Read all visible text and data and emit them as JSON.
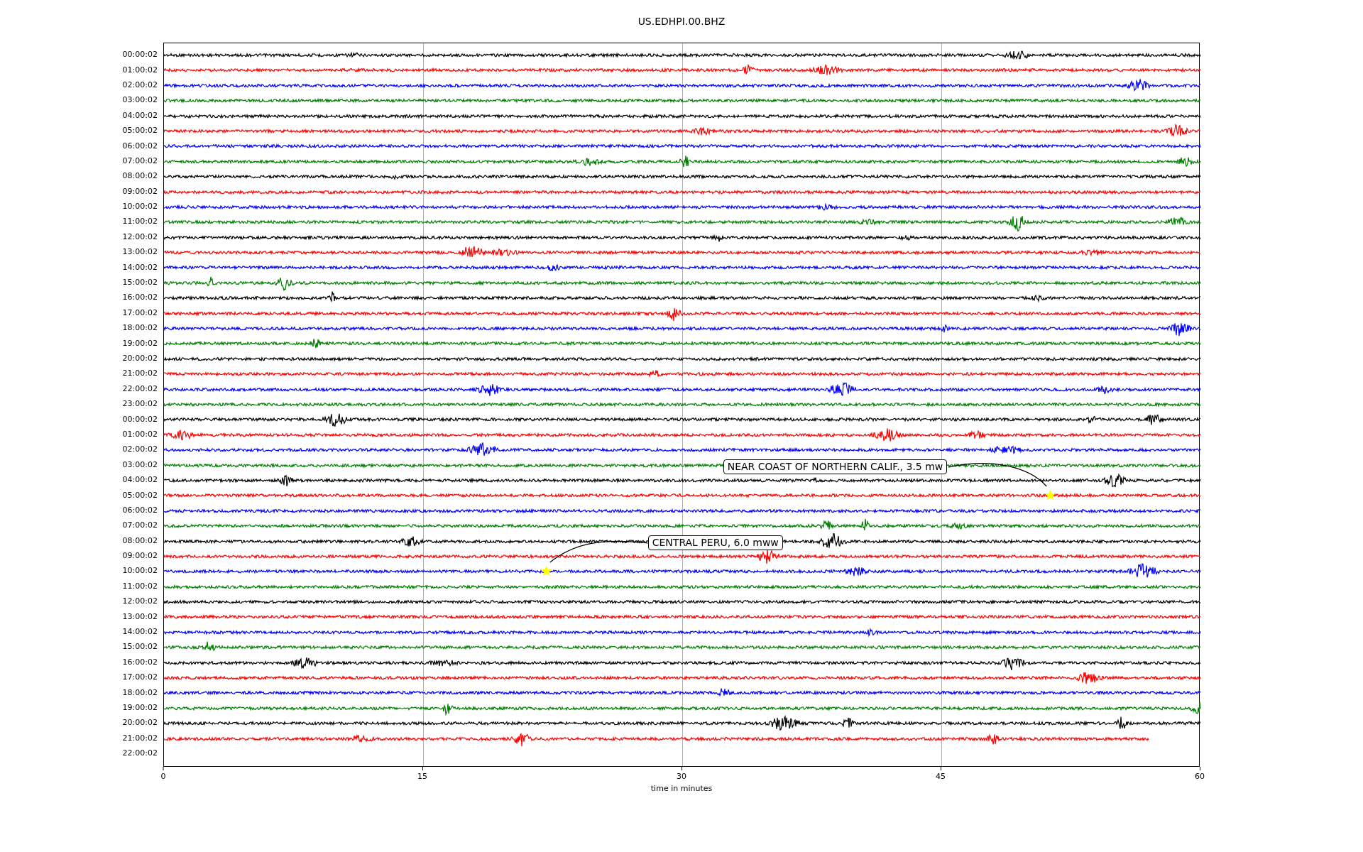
{
  "title": "US.EDHPI.00.BHZ",
  "rows": [
    {
      "label": "00:00:02",
      "color": "#000000",
      "kind": "full"
    },
    {
      "label": "01:00:02",
      "color": "#ff0000",
      "kind": "full"
    },
    {
      "label": "02:00:02",
      "color": "#0000ff",
      "kind": "full"
    },
    {
      "label": "03:00:02",
      "color": "#008000",
      "kind": "full"
    },
    {
      "label": "04:00:02",
      "color": "#000000",
      "kind": "full"
    },
    {
      "label": "05:00:02",
      "color": "#ff0000",
      "kind": "full"
    },
    {
      "label": "06:00:02",
      "color": "#0000ff",
      "kind": "full"
    },
    {
      "label": "07:00:02",
      "color": "#008000",
      "kind": "full"
    },
    {
      "label": "08:00:02",
      "color": "#000000",
      "kind": "full"
    },
    {
      "label": "09:00:02",
      "color": "#ff0000",
      "kind": "full"
    },
    {
      "label": "10:00:02",
      "color": "#0000ff",
      "kind": "full"
    },
    {
      "label": "11:00:02",
      "color": "#008000",
      "kind": "full"
    },
    {
      "label": "12:00:02",
      "color": "#000000",
      "kind": "full"
    },
    {
      "label": "13:00:02",
      "color": "#ff0000",
      "kind": "full"
    },
    {
      "label": "14:00:02",
      "color": "#0000ff",
      "kind": "full"
    },
    {
      "label": "15:00:02",
      "color": "#008000",
      "kind": "full"
    },
    {
      "label": "16:00:02",
      "color": "#000000",
      "kind": "full"
    },
    {
      "label": "17:00:02",
      "color": "#ff0000",
      "kind": "full"
    },
    {
      "label": "18:00:02",
      "color": "#0000ff",
      "kind": "full"
    },
    {
      "label": "19:00:02",
      "color": "#008000",
      "kind": "full"
    },
    {
      "label": "20:00:02",
      "color": "#000000",
      "kind": "full"
    },
    {
      "label": "21:00:02",
      "color": "#ff0000",
      "kind": "full"
    },
    {
      "label": "22:00:02",
      "color": "#0000ff",
      "kind": "full"
    },
    {
      "label": "23:00:02",
      "color": "#008000",
      "kind": "full"
    },
    {
      "label": "00:00:02",
      "color": "#000000",
      "kind": "full"
    },
    {
      "label": "01:00:02",
      "color": "#ff0000",
      "kind": "full"
    },
    {
      "label": "02:00:02",
      "color": "#0000ff",
      "kind": "full"
    },
    {
      "label": "03:00:02",
      "color": "#008000",
      "kind": "full"
    },
    {
      "label": "04:00:02",
      "color": "#000000",
      "kind": "full"
    },
    {
      "label": "05:00:02",
      "color": "#ff0000",
      "kind": "full",
      "event": {
        "text": "NEAR COAST OF NORTHERN CALIF., 3.5 mw",
        "level": 0.855,
        "kind": "left"
      }
    },
    {
      "label": "06:00:02",
      "color": "#0000ff",
      "kind": "full"
    },
    {
      "label": "07:00:02",
      "color": "#008000",
      "kind": "full"
    },
    {
      "label": "08:00:02",
      "color": "#000000",
      "kind": "full"
    },
    {
      "label": "09:00:02",
      "color": "#ff0000",
      "kind": "full"
    },
    {
      "label": "10:00:02",
      "color": "#0000ff",
      "kind": "full",
      "event": {
        "text": "CENTRAL PERU, 6.0 mww",
        "level": 0.369,
        "kind": "right"
      }
    },
    {
      "label": "11:00:02",
      "color": "#008000",
      "kind": "full"
    },
    {
      "label": "12:00:02",
      "color": "#000000",
      "kind": "full"
    },
    {
      "label": "13:00:02",
      "color": "#ff0000",
      "kind": "full"
    },
    {
      "label": "14:00:02",
      "color": "#0000ff",
      "kind": "full"
    },
    {
      "label": "15:00:02",
      "color": "#008000",
      "kind": "full"
    },
    {
      "label": "16:00:02",
      "color": "#000000",
      "kind": "full"
    },
    {
      "label": "17:00:02",
      "color": "#ff0000",
      "kind": "full"
    },
    {
      "label": "18:00:02",
      "color": "#0000ff",
      "kind": "full"
    },
    {
      "label": "19:00:02",
      "color": "#008000",
      "kind": "full"
    },
    {
      "label": "20:00:02",
      "color": "#000000",
      "kind": "full"
    },
    {
      "label": "21:00:02",
      "color": "#ff0000",
      "kind": "partial"
    },
    {
      "label": "22:00:02",
      "kind": "empty"
    }
  ],
  "xticks": [
    "0",
    "15",
    "30",
    "45",
    "60"
  ],
  "xlabel": "time in minutes"
}
